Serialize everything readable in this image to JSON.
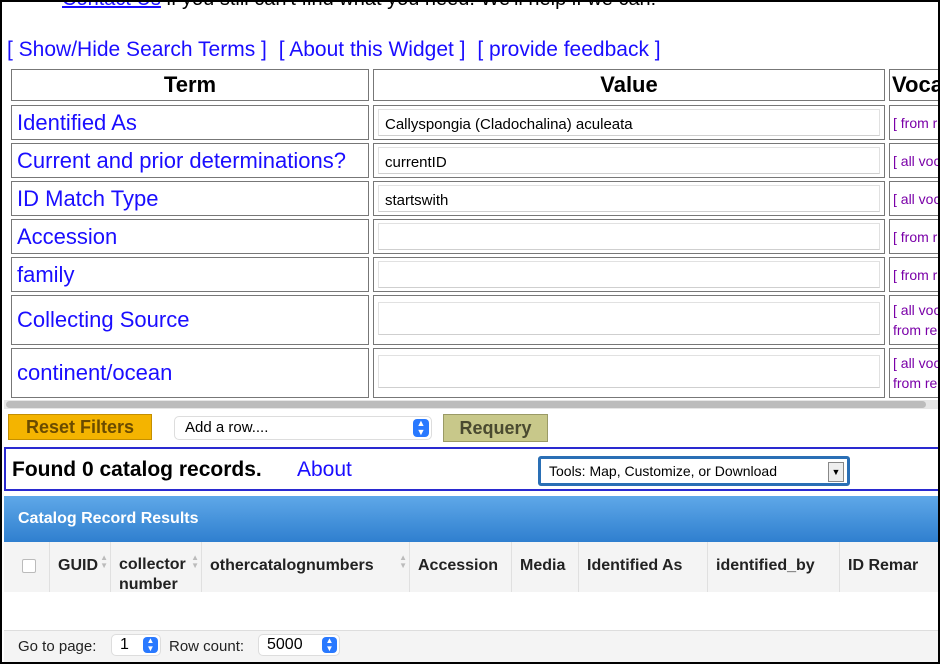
{
  "top_note": {
    "link": "Contact Us",
    "text": " if you still can't find what you need. We'll help if we can!"
  },
  "widget_links": [
    "[ Show/Hide Search Terms ]",
    "[ About this Widget ]",
    "[ provide feedback ]"
  ],
  "table": {
    "headers": {
      "term": "Term",
      "value": "Value",
      "vocab": "Voca"
    },
    "rows": [
      {
        "term": "Identified As",
        "value": "Callyspongia (Cladochalina) aculeata",
        "vocab1": "[ from r",
        "vocab2": ""
      },
      {
        "term": "Current and prior determinations?",
        "value": "currentID",
        "vocab1": "[ all voc",
        "vocab2": ""
      },
      {
        "term": "ID Match Type",
        "value": "startswith",
        "vocab1": "[ all voc",
        "vocab2": ""
      },
      {
        "term": "Accession",
        "value": "",
        "vocab1": "[ from r",
        "vocab2": ""
      },
      {
        "term": "family",
        "value": "",
        "vocab1": "[ from r",
        "vocab2": ""
      },
      {
        "term": "Collecting Source",
        "value": "",
        "vocab1": "[ all voc",
        "vocab2": "from re"
      },
      {
        "term": "continent/ocean",
        "value": "",
        "vocab1": "[ all voc",
        "vocab2": "from re"
      }
    ]
  },
  "controls": {
    "reset_label": "Reset Filters",
    "add_row_value": "Add a row....",
    "requery_label": "Requery"
  },
  "found": {
    "text": "Found 0 catalog records.",
    "about": "About",
    "tools_value": "Tools: Map, Customize, or Download"
  },
  "results": {
    "title": "Catalog Record Results",
    "columns": [
      "GUID",
      "collector number",
      "othercatalognumbers",
      "Accession",
      "Media",
      "Identified As",
      "identified_by",
      "ID Remar"
    ]
  },
  "pager": {
    "goto_label": "Go to page:",
    "page_value": "1",
    "rowcount_label": "Row count:",
    "rowcount_value": "5000"
  }
}
